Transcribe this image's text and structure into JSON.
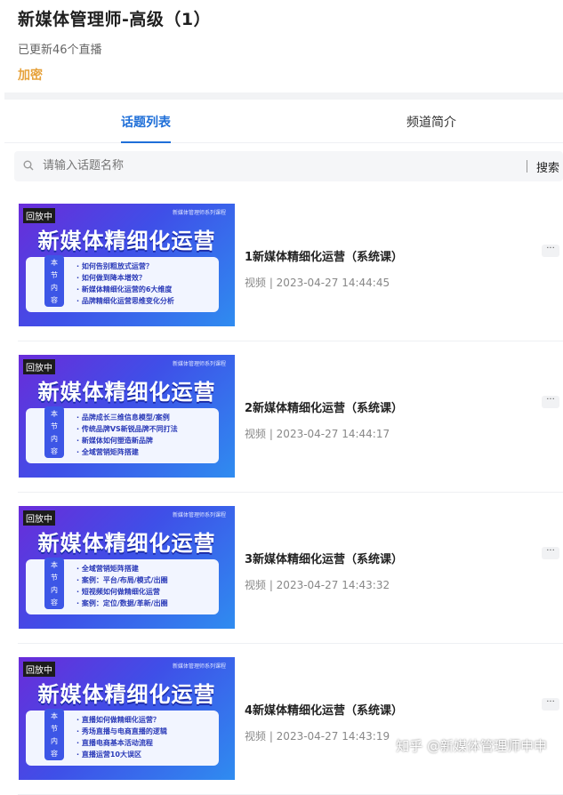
{
  "header": {
    "title": "新媒体管理师-高级（1）",
    "subtitle": "已更新46个直播",
    "tag": "加密"
  },
  "tabs": [
    {
      "label": "话题列表",
      "active": true
    },
    {
      "label": "频道简介",
      "active": false
    }
  ],
  "search": {
    "placeholder": "请输入话题名称",
    "button": "搜索"
  },
  "items": [
    {
      "badge": "回放中",
      "corner": "新媒体管理师系列课程",
      "thumb_title": "新媒体精细化运营",
      "section": "本节内容",
      "points": [
        "· 如何告别粗放式运营？",
        "· 如何做到降本增效？",
        "· 新媒体精细化运营的6大维度",
        "· 品牌精细化运营思维变化分析"
      ],
      "title": "1新媒体精细化运营（系统课）",
      "sub": "视频 | 2023-04-27 14:44:45",
      "more": "···"
    },
    {
      "badge": "回放中",
      "corner": "新媒体管理师系列课程",
      "thumb_title": "新媒体精细化运营",
      "section": "本节内容",
      "points": [
        "· 品牌成长三维信息模型/案例",
        "· 传统品牌VS新锐品牌不同打法",
        "· 新媒体如何塑造新品牌",
        "· 全域营销矩阵搭建"
      ],
      "title": "2新媒体精细化运营（系统课）",
      "sub": "视频 | 2023-04-27 14:44:17",
      "more": "···"
    },
    {
      "badge": "回放中",
      "corner": "新媒体管理师系列课程",
      "thumb_title": "新媒体精细化运营",
      "section": "本节内容",
      "points": [
        "· 全域营销矩阵搭建",
        "· 案例：平台/布局/模式/出圈",
        "· 短视频如何做精细化运营",
        "· 案例：定位/数据/革新/出圈"
      ],
      "title": "3新媒体精细化运营（系统课）",
      "sub": "视频 | 2023-04-27 14:43:32",
      "more": "···"
    },
    {
      "badge": "回放中",
      "corner": "新媒体管理师系列课程",
      "thumb_title": "新媒体精细化运营",
      "section": "本节内容",
      "points": [
        "· 直播如何做精细化运营？",
        "· 秀场直播与电商直播的逻辑",
        "· 直播电商基本活动流程",
        "· 直播运营10大误区"
      ],
      "title": "4新媒体精细化运营（系统课）",
      "sub": "视频 | 2023-04-27 14:43:19",
      "more": "···"
    }
  ],
  "watermark": "知乎 @新媒体管理师申申"
}
